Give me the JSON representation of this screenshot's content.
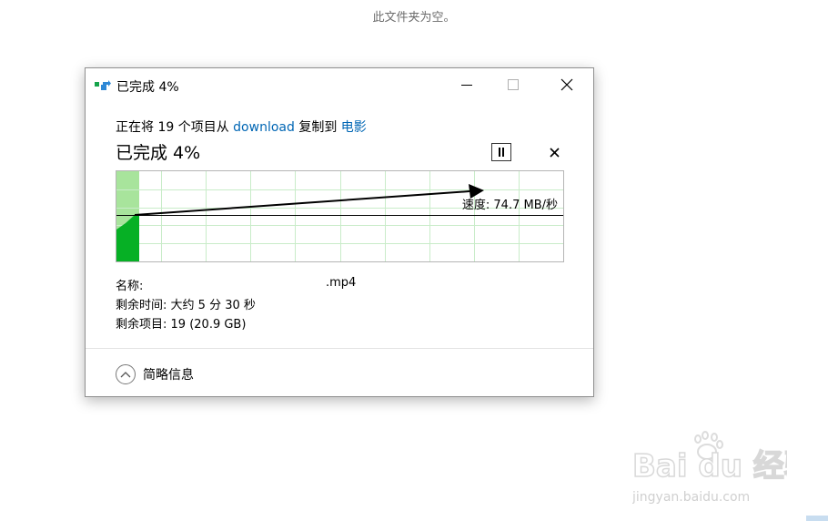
{
  "background": {
    "empty_folder_text": "此文件夹为空。"
  },
  "dialog": {
    "title": "已完成 4%",
    "status": {
      "prefix": "正在将 19 个项目从",
      "source": "download",
      "middle": "复制到",
      "destination": "电影"
    },
    "percent_text": "已完成 4%",
    "progress": 0.04,
    "speed_text": "速度: 74.7 MB/秒",
    "name_label": "名称:",
    "name_value": ".mp4",
    "time_label": "剩余时间:",
    "time_value": "大约 5 分 30 秒",
    "items_label": "剩余项目:",
    "items_value": "19 (20.9 GB)",
    "details_toggle": "简略信息"
  },
  "watermark": {
    "brand": "Bai du 经验",
    "url": "jingyan.baidu.com"
  },
  "colors": {
    "link": "#0066b4",
    "graph_fill": "#06b025",
    "graph_fill_light": "#a8e49c",
    "grid": "#c9ecc9"
  },
  "icons": [
    "copy-icon",
    "minimize-icon",
    "maximize-icon",
    "close-icon",
    "pause-icon",
    "cancel-icon",
    "chevron-up-icon"
  ]
}
